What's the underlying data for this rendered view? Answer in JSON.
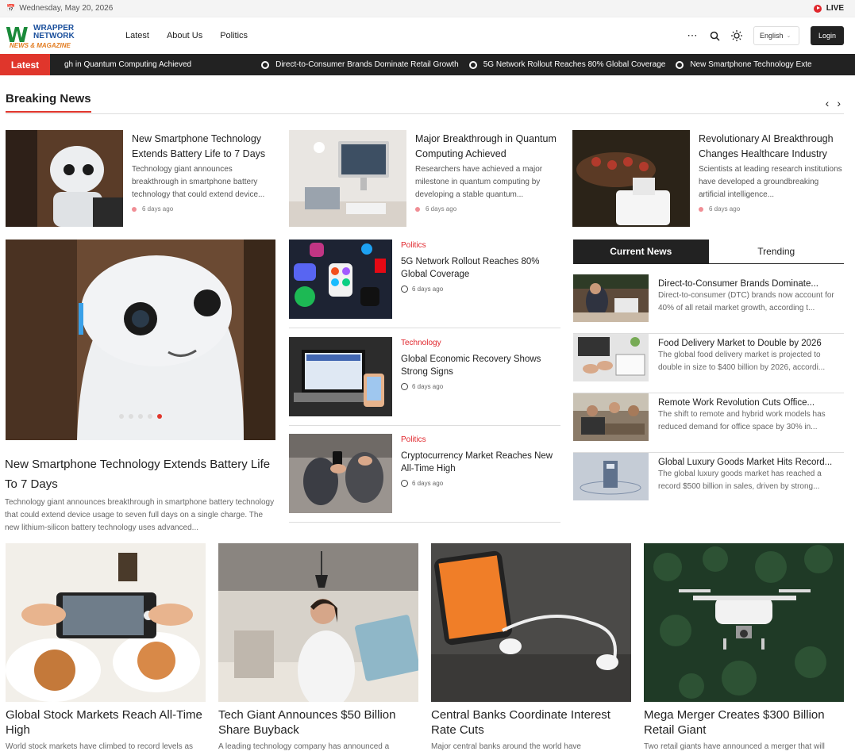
{
  "topbar": {
    "date": "Wednesday, May 20, 2026",
    "live": "LIVE"
  },
  "header": {
    "logo_main": "W",
    "logo_line1": "WRAPPER",
    "logo_line2": "NETWORK",
    "logo_tag": "NEWS & MAGAZINE",
    "nav": [
      "Latest",
      "About Us",
      "Politics"
    ],
    "language": "English",
    "login": "Login"
  },
  "ticker": {
    "tag": "Latest",
    "items": [
      "gh in Quantum Computing Achieved",
      "Direct-to-Consumer Brands Dominate Retail Growth",
      "5G Network Rollout Reaches 80% Global Coverage",
      "New Smartphone Technology Exte"
    ]
  },
  "breaking": {
    "title": "Breaking News",
    "top": [
      {
        "title": "New Smartphone Technology Extends Battery Life to 7 Days",
        "excerpt": "Technology giant announces breakthrough in smartphone battery technology that could extend device...",
        "time": "6 days ago"
      },
      {
        "title": "Major Breakthrough in Quantum Computing Achieved",
        "excerpt": "Researchers have achieved a major milestone in quantum computing by developing a stable quantum...",
        "time": "6 days ago"
      },
      {
        "title": "Revolutionary AI Breakthrough Changes Healthcare Industry",
        "excerpt": "Scientists at leading research institutions have developed a groundbreaking artificial intelligence...",
        "time": "6 days ago"
      }
    ],
    "featured": {
      "title": "New Smartphone Technology Extends Battery Life To 7 Days",
      "excerpt": "Technology giant announces breakthrough in smartphone battery technology that could extend device usage to seven full days on a single charge. The new lithium-silicon battery technology uses advanced..."
    },
    "middle": [
      {
        "category": "Politics",
        "title": "5G Network Rollout Reaches 80% Global Coverage",
        "time": "6 days ago"
      },
      {
        "category": "Technology",
        "title": "Global Economic Recovery Shows Strong Signs",
        "time": "6 days ago"
      },
      {
        "category": "Politics",
        "title": "Cryptocurrency Market Reaches New All-Time High",
        "time": "6 days ago"
      }
    ]
  },
  "tabs": {
    "current": "Current News",
    "trending": "Trending"
  },
  "current": [
    {
      "title": "Direct-to-Consumer Brands Dominate...",
      "excerpt": "Direct-to-consumer (DTC) brands now account for 40% of all retail market growth, according t..."
    },
    {
      "title": "Food Delivery Market to Double by 2026",
      "excerpt": "The global food delivery market is projected to double in size to $400 billion by 2026, accordi..."
    },
    {
      "title": "Remote Work Revolution Cuts Office...",
      "excerpt": "The shift to remote and hybrid work models has reduced demand for office space by 30% in..."
    },
    {
      "title": "Global Luxury Goods Market Hits Record...",
      "excerpt": "The global luxury goods market has reached a record $500 billion in sales, driven by strong..."
    }
  ],
  "cards": [
    {
      "title": "Global Stock Markets Reach All-Time High",
      "excerpt": "World stock markets have climbed to record levels as"
    },
    {
      "title": "Tech Giant Announces $50 Billion Share Buyback",
      "excerpt": "A leading technology company has announced a"
    },
    {
      "title": "Central Banks Coordinate Interest Rate Cuts",
      "excerpt": "Major central banks around the world have"
    },
    {
      "title": "Mega Merger Creates $300 Billion Retail Giant",
      "excerpt": "Two retail giants have announced a merger that will"
    }
  ],
  "colors": {
    "accent": "#e0362c",
    "dark": "#222222"
  }
}
